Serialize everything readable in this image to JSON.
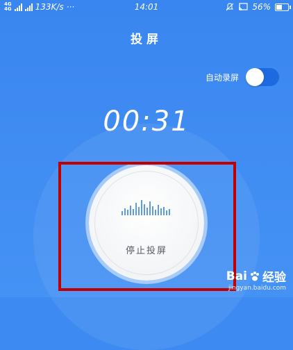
{
  "status_bar": {
    "network_top": "4G",
    "network_bottom": "4G",
    "speed": "133K/s",
    "dots": "···",
    "time": "14:01",
    "battery": "56%",
    "battery_level": 0.56
  },
  "page": {
    "title": "投屏",
    "auto_record_label": "自动录屏",
    "auto_record_on": false,
    "timer": "00:31",
    "stop_label": "停止投屏"
  },
  "colors": {
    "background": "#3d8bf2",
    "toggle_track": "#1d6ae0",
    "highlight_box": "#c00000",
    "wave": "#5d9ae6"
  },
  "watermark": {
    "brand": "Bai",
    "brand_suffix": "经验",
    "url": "jingyan.baidu.com"
  }
}
